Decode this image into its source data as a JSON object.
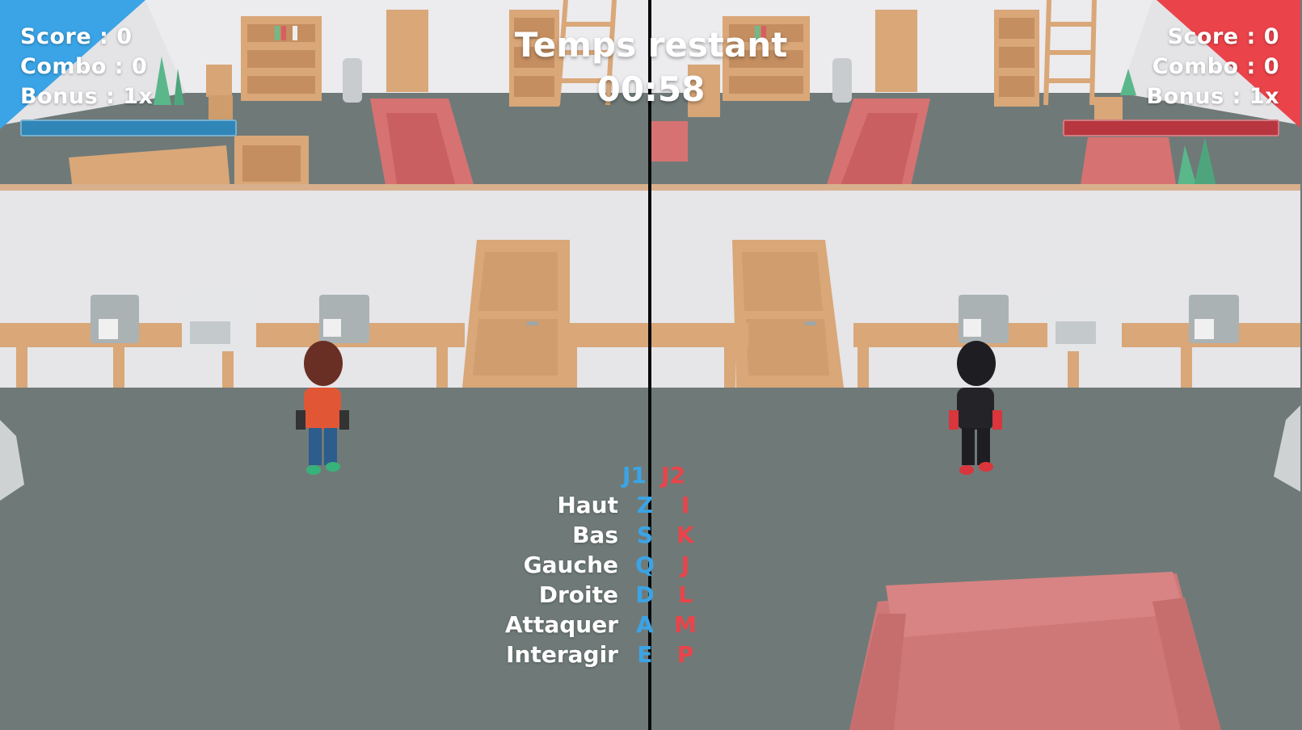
{
  "player1": {
    "score": "Score : 0",
    "combo": "Combo : 0",
    "bonus": "Bonus : 1x",
    "color": "#3aa4e6",
    "energy_fraction": 1.0
  },
  "player2": {
    "score": "Score : 0",
    "combo": "Combo : 0",
    "bonus": "Bonus : 1x",
    "color": "#ea4349",
    "energy_fraction": 1.0
  },
  "timer": {
    "label": "Temps restant",
    "value": "00:58"
  },
  "controls": {
    "header_j1": "J1",
    "header_j2": "J2",
    "rows": [
      {
        "action": "Haut",
        "j1": "Z",
        "j2": "I"
      },
      {
        "action": "Bas",
        "j1": "S",
        "j2": "K"
      },
      {
        "action": "Gauche",
        "j1": "Q",
        "j2": "J"
      },
      {
        "action": "Droite",
        "j1": "D",
        "j2": "L"
      },
      {
        "action": "Attaquer",
        "j1": "A",
        "j2": "M"
      },
      {
        "action": "Interagir",
        "j1": "E",
        "j2": "P"
      }
    ]
  }
}
